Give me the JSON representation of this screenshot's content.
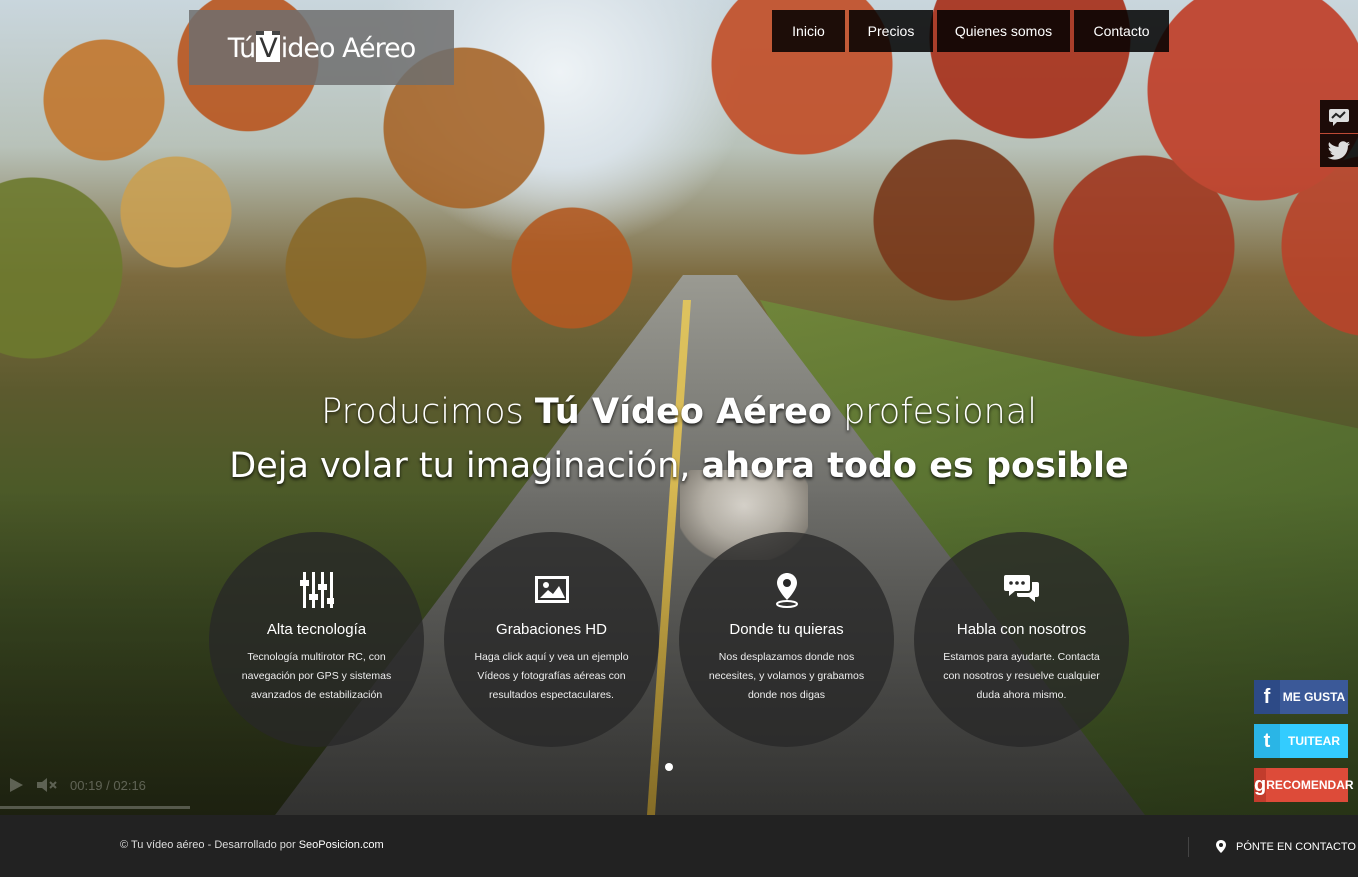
{
  "logo": {
    "pre": "Tú",
    "mid": "V",
    "post1": "ideo",
    "post2": "Aéreo"
  },
  "nav": {
    "items": [
      "Inicio",
      "Precios",
      "Quienes somos",
      "Contacto"
    ]
  },
  "hero": {
    "line1_a": "Producimos ",
    "line1_b": "Tú Vídeo Aéreo",
    "line1_c": " profesional",
    "line2_a": "Deja volar tu imaginación, ",
    "line2_b": "ahora todo es posible"
  },
  "features": [
    {
      "icon": "sliders-icon",
      "title": "Alta tecnología",
      "text": "Tecnología multirotor RC, con navegación por GPS y sistemas avanzados de estabilización"
    },
    {
      "icon": "image-icon",
      "title": "Grabaciones HD",
      "text": "Haga click aquí y vea un ejemplo Vídeos y fotografías aéreas con resultados espectaculares."
    },
    {
      "icon": "map-pin-icon",
      "title": "Donde tu quieras",
      "text": "Nos desplazamos donde nos necesites, y volamos y grabamos donde nos digas"
    },
    {
      "icon": "chat-icon",
      "title": "Habla con nosotros",
      "text": "Estamos para ayudarte. Contacta con nosotros y resuelve cualquier duda ahora mismo."
    }
  ],
  "video": {
    "time": "00:19 / 02:16"
  },
  "social": {
    "facebook": {
      "label": "ME GUSTA",
      "icon_text": "f",
      "color": "#3b5998"
    },
    "twitter": {
      "label": "TUITEAR",
      "icon_text": "t",
      "color": "#33ccff"
    },
    "google": {
      "label": "RECOMENDAR",
      "icon_text": "g",
      "color": "#dd4b39"
    }
  },
  "footer": {
    "copy_prefix": "© Tu vídeo aéreo - Desarrollado por ",
    "brand": "SeoPosicion.com",
    "contact": "PÓNTE EN CONTACTO"
  },
  "colors": {
    "footer_bg": "#222222",
    "nav_bg": "#000000",
    "circle_bg": "#282828"
  }
}
